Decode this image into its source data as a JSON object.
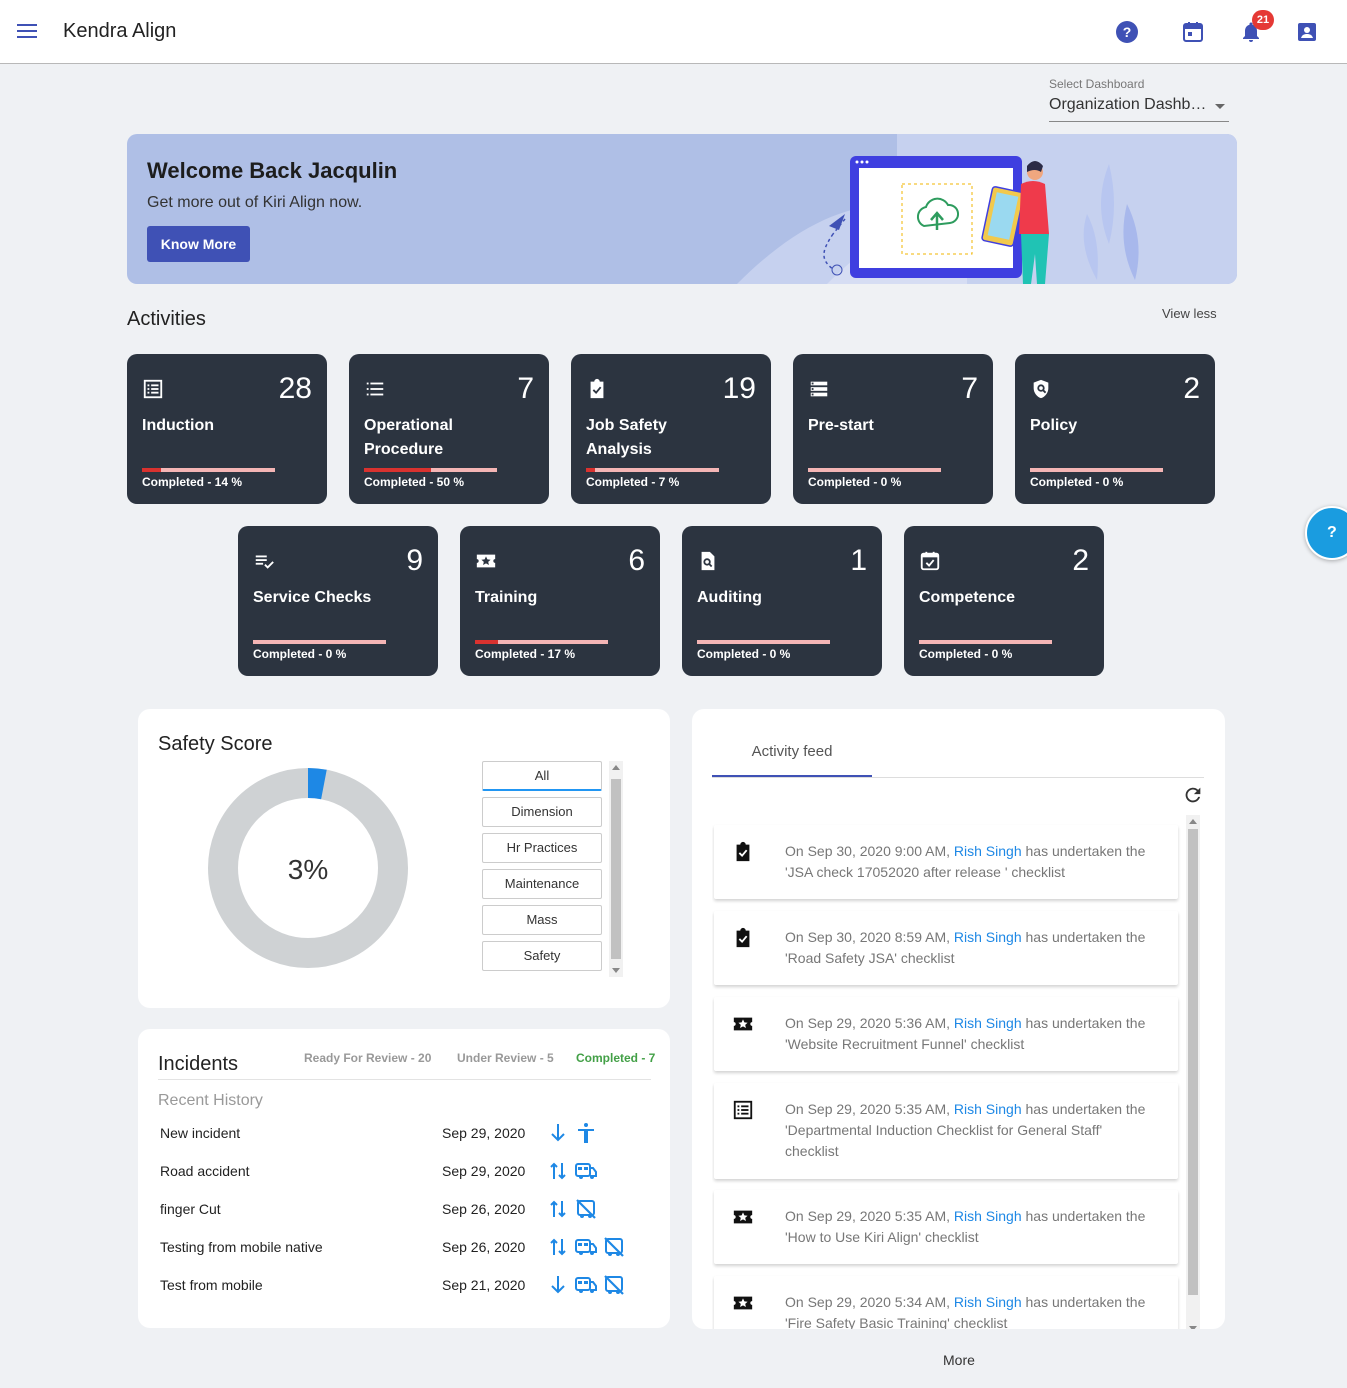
{
  "app": {
    "title": "Kendra Align",
    "notification_count": "21"
  },
  "dashboard_select": {
    "label": "Select Dashboard",
    "value": "Organization Dashboard"
  },
  "banner": {
    "title": "Welcome Back Jacqulin",
    "subtitle": "Get more out of Kiri Align now.",
    "button": "Know More"
  },
  "activities": {
    "title": "Activities",
    "toggle": "View less",
    "cards": [
      {
        "icon": "list-icon",
        "count": "28",
        "label": "Induction",
        "completed_text": "Completed - 14 %",
        "progress": 14
      },
      {
        "icon": "bullet-list-icon",
        "count": "7",
        "label": "Operational Procedure",
        "completed_text": "Completed - 50 %",
        "progress": 50
      },
      {
        "icon": "clipboard-check-icon",
        "count": "19",
        "label": "Job Safety Analysis",
        "completed_text": "Completed - 7 %",
        "progress": 7
      },
      {
        "icon": "storage-icon",
        "count": "7",
        "label": "Pre-start",
        "completed_text": "Completed - 0 %",
        "progress": 0
      },
      {
        "icon": "policy-shield-icon",
        "count": "2",
        "label": "Policy",
        "completed_text": "Completed - 0 %",
        "progress": 0
      },
      {
        "icon": "playlist-check-icon",
        "count": "9",
        "label": "Service Checks",
        "completed_text": "Completed - 0 %",
        "progress": 0
      },
      {
        "icon": "star-ticket-icon",
        "count": "6",
        "label": "Training",
        "completed_text": "Completed - 17 %",
        "progress": 17
      },
      {
        "icon": "find-document-icon",
        "count": "1",
        "label": "Auditing",
        "completed_text": "Completed - 0 %",
        "progress": 0
      },
      {
        "icon": "calendar-check-icon",
        "count": "2",
        "label": "Competence",
        "completed_text": "Completed - 0 %",
        "progress": 0
      }
    ]
  },
  "safety_score": {
    "title": "Safety Score",
    "value_text": "3%",
    "value": 3,
    "colors": {
      "filled": "#1e88e5",
      "rest": "#cfd2d4"
    },
    "filters": [
      "All",
      "Dimension",
      "Hr Practices",
      "Maintenance",
      "Mass",
      "Safety"
    ],
    "active_filter": "All"
  },
  "incidents": {
    "title": "Incidents",
    "stats": {
      "ready": "Ready For Review - 20",
      "under": "Under Review - 5",
      "completed": "Completed - 7"
    },
    "recent_title": "Recent History",
    "rows": [
      {
        "name": "New incident",
        "date": "Sep 29, 2020",
        "icons": [
          "arrow-down-icon",
          "accessibility-icon"
        ]
      },
      {
        "name": "Road accident",
        "date": "Sep 29, 2020",
        "icons": [
          "swap-vert-icon",
          "bus-icon"
        ]
      },
      {
        "name": "finger Cut",
        "date": "Sep 26, 2020",
        "icons": [
          "swap-vert-icon",
          "bus-off-icon"
        ]
      },
      {
        "name": "Testing from mobile native",
        "date": "Sep 26, 2020",
        "icons": [
          "swap-vert-icon",
          "bus-icon",
          "bus-off-icon"
        ]
      },
      {
        "name": "Test from mobile",
        "date": "Sep 21, 2020",
        "icons": [
          "arrow-down-icon",
          "bus-icon",
          "bus-off-icon"
        ]
      }
    ]
  },
  "activity_feed": {
    "tab": "Activity feed",
    "more": "More",
    "items": [
      {
        "icon": "clipboard-check-icon",
        "prefix": "On Sep 30, 2020 9:00 AM, ",
        "user": "Rish Singh",
        "suffix": " has undertaken the 'JSA check 17052020 after release ' checklist"
      },
      {
        "icon": "clipboard-check-icon",
        "prefix": "On Sep 30, 2020 8:59 AM, ",
        "user": "Rish Singh",
        "suffix": " has undertaken the 'Road Safety JSA' checklist"
      },
      {
        "icon": "star-ticket-icon",
        "prefix": "On Sep 29, 2020 5:36 AM, ",
        "user": "Rish Singh",
        "suffix": " has undertaken the 'Website Recruitment Funnel' checklist"
      },
      {
        "icon": "list-icon",
        "prefix": "On Sep 29, 2020 5:35 AM, ",
        "user": "Rish Singh",
        "suffix": " has undertaken the 'Departmental Induction Checklist for General Staff' checklist"
      },
      {
        "icon": "star-ticket-icon",
        "prefix": "On Sep 29, 2020 5:35 AM, ",
        "user": "Rish Singh",
        "suffix": " has undertaken the 'How to Use Kiri Align' checklist"
      },
      {
        "icon": "star-ticket-icon",
        "prefix": "On Sep 29, 2020 5:34 AM, ",
        "user": "Rish Singh",
        "suffix": " has undertaken the 'Fire Safety Basic Training' checklist"
      }
    ]
  }
}
